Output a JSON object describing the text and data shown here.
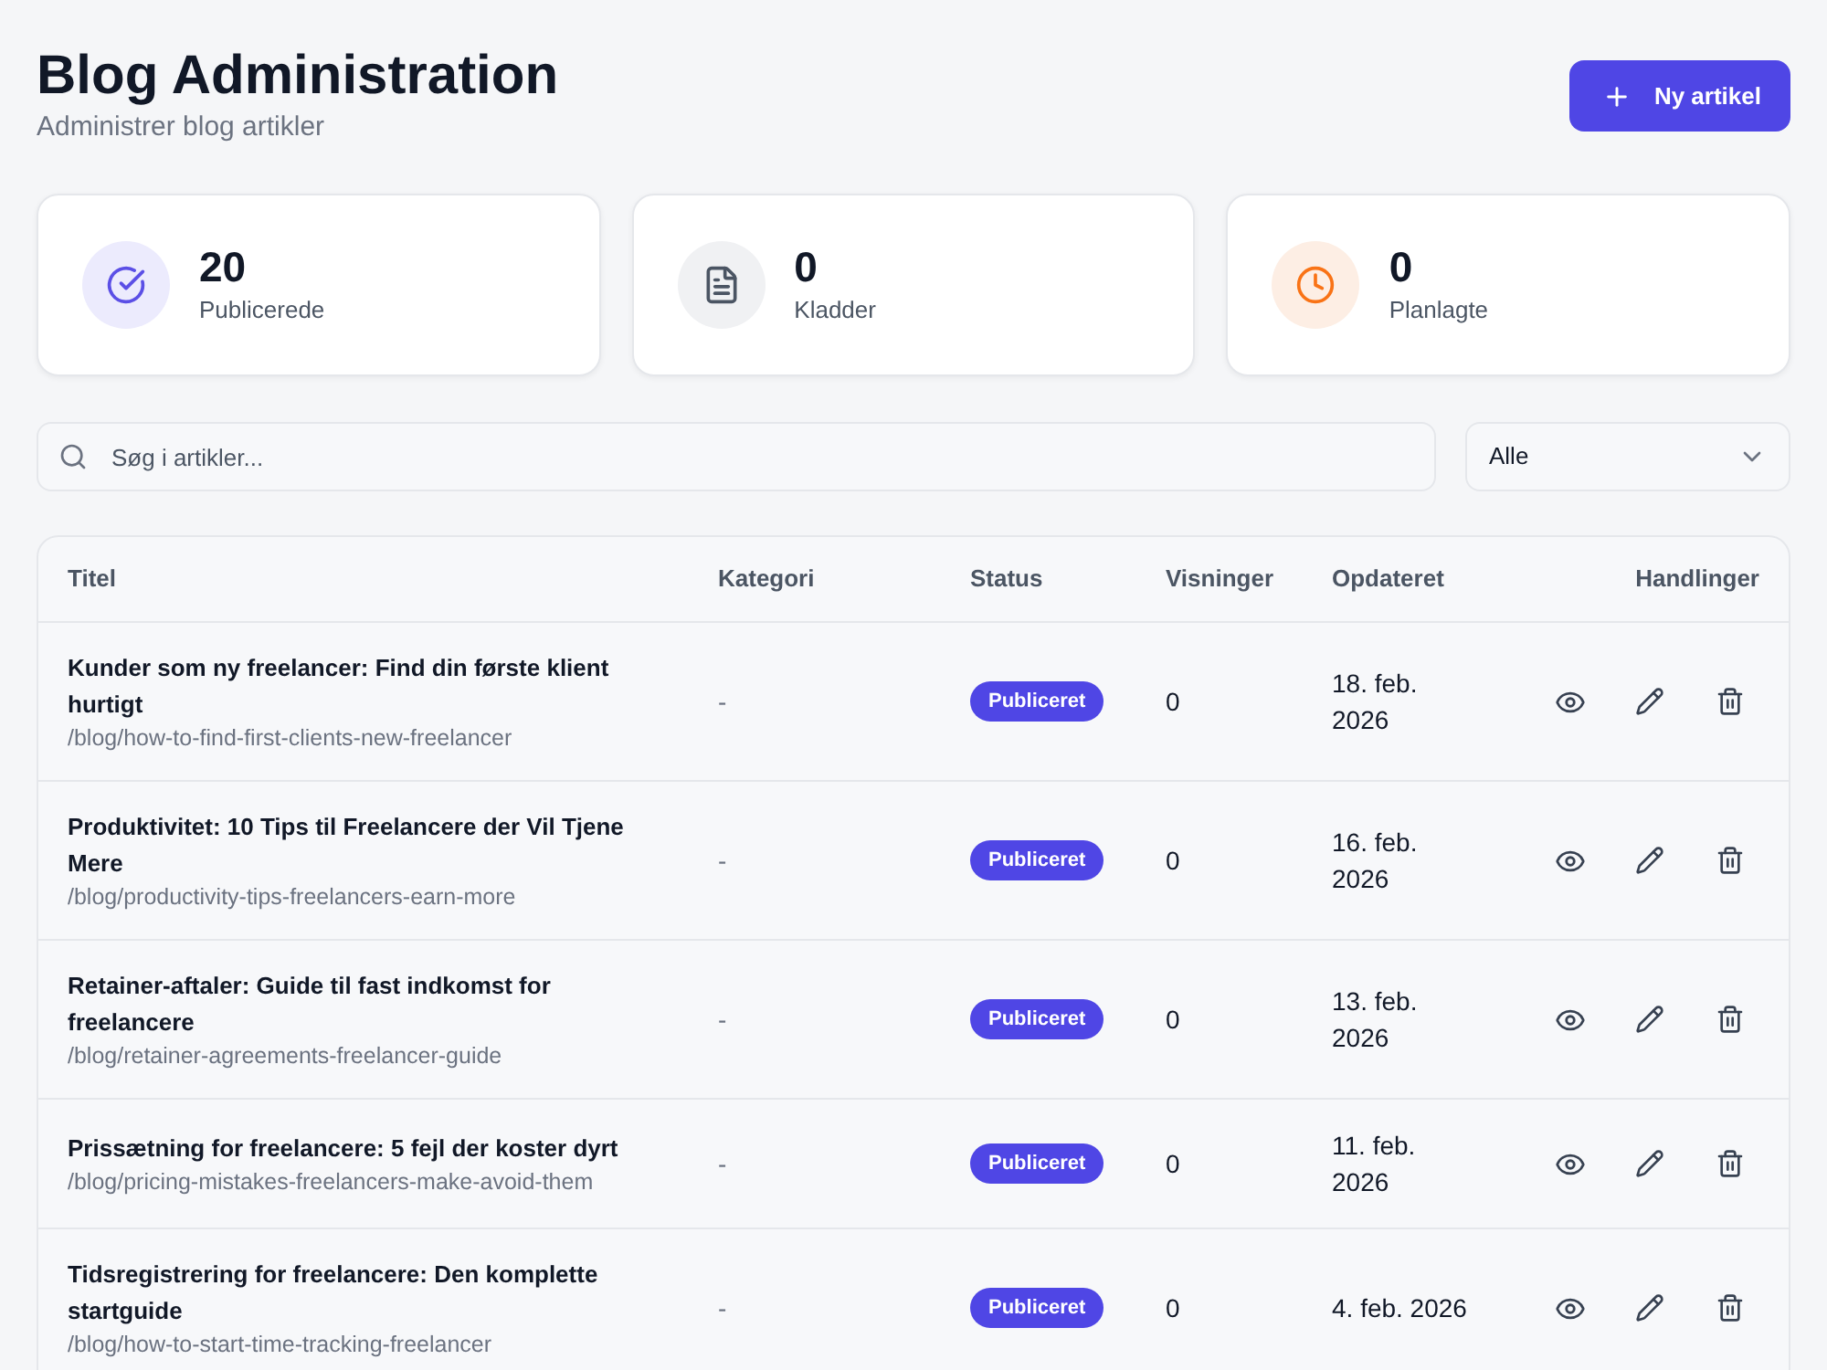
{
  "header": {
    "title": "Blog Administration",
    "subtitle": "Administrer blog artikler",
    "new_button": "Ny artikel"
  },
  "stats": [
    {
      "kind": "published",
      "value": "20",
      "label": "Publicerede"
    },
    {
      "kind": "drafts",
      "value": "0",
      "label": "Kladder"
    },
    {
      "kind": "scheduled",
      "value": "0",
      "label": "Planlagte"
    }
  ],
  "search": {
    "placeholder": "Søg i artikler..."
  },
  "filter": {
    "value": "Alle"
  },
  "table": {
    "columns": [
      "Titel",
      "Kategori",
      "Status",
      "Visninger",
      "Opdateret",
      "Handlinger"
    ],
    "rows": [
      {
        "title": "Kunder som ny freelancer: Find din første klient hurtigt",
        "slug": "/blog/how-to-find-first-clients-new-freelancer",
        "category": "-",
        "status": "Publiceret",
        "views": "0",
        "updated": "18. feb. 2026"
      },
      {
        "title": "Produktivitet: 10 Tips til Freelancere der Vil Tjene Mere",
        "slug": "/blog/productivity-tips-freelancers-earn-more",
        "category": "-",
        "status": "Publiceret",
        "views": "0",
        "updated": "16. feb. 2026"
      },
      {
        "title": "Retainer-aftaler: Guide til fast indkomst for freelancere",
        "slug": "/blog/retainer-agreements-freelancer-guide",
        "category": "-",
        "status": "Publiceret",
        "views": "0",
        "updated": "13. feb. 2026"
      },
      {
        "title": "Prissætning for freelancere: 5 fejl der koster dyrt",
        "slug": "/blog/pricing-mistakes-freelancers-make-avoid-them",
        "category": "-",
        "status": "Publiceret",
        "views": "0",
        "updated": "11. feb. 2026"
      },
      {
        "title": "Tidsregistrering for freelancere: Den komplette startguide",
        "slug": "/blog/how-to-start-time-tracking-freelancer",
        "category": "-",
        "status": "Publiceret",
        "views": "0",
        "updated": "4. feb. 2026"
      }
    ]
  }
}
